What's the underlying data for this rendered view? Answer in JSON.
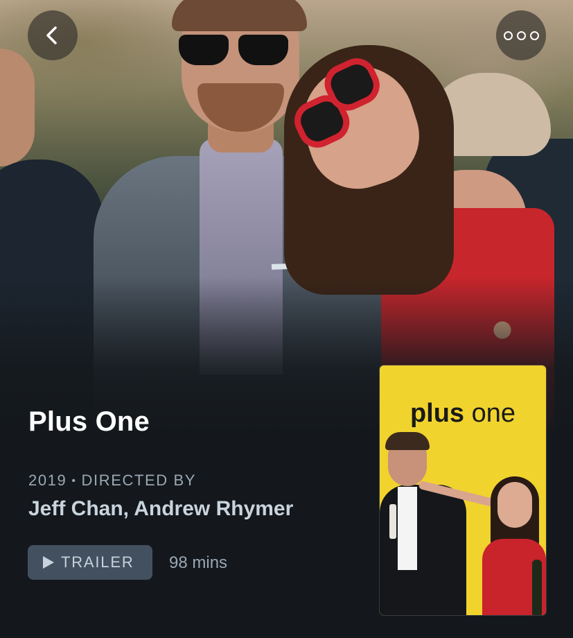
{
  "movie": {
    "title": "Plus One",
    "year": "2019",
    "separator": "•",
    "directed_by_label": "DIRECTED BY",
    "directors": "Jeff Chan, Andrew Rhymer",
    "trailer_label": "TRAILER",
    "runtime": "98 mins"
  },
  "poster": {
    "title_bold": "plus",
    "title_light": "one",
    "background_color": "#f1d32e"
  },
  "icons": {
    "back": "chevron-left-icon",
    "more": "more-options-icon",
    "play": "play-icon"
  },
  "colors": {
    "page_background": "#14181c",
    "title_text": "#ffffff",
    "meta_text": "#9aa8b5",
    "directors_text": "#c9d4de",
    "trailer_button": "#43505f"
  }
}
